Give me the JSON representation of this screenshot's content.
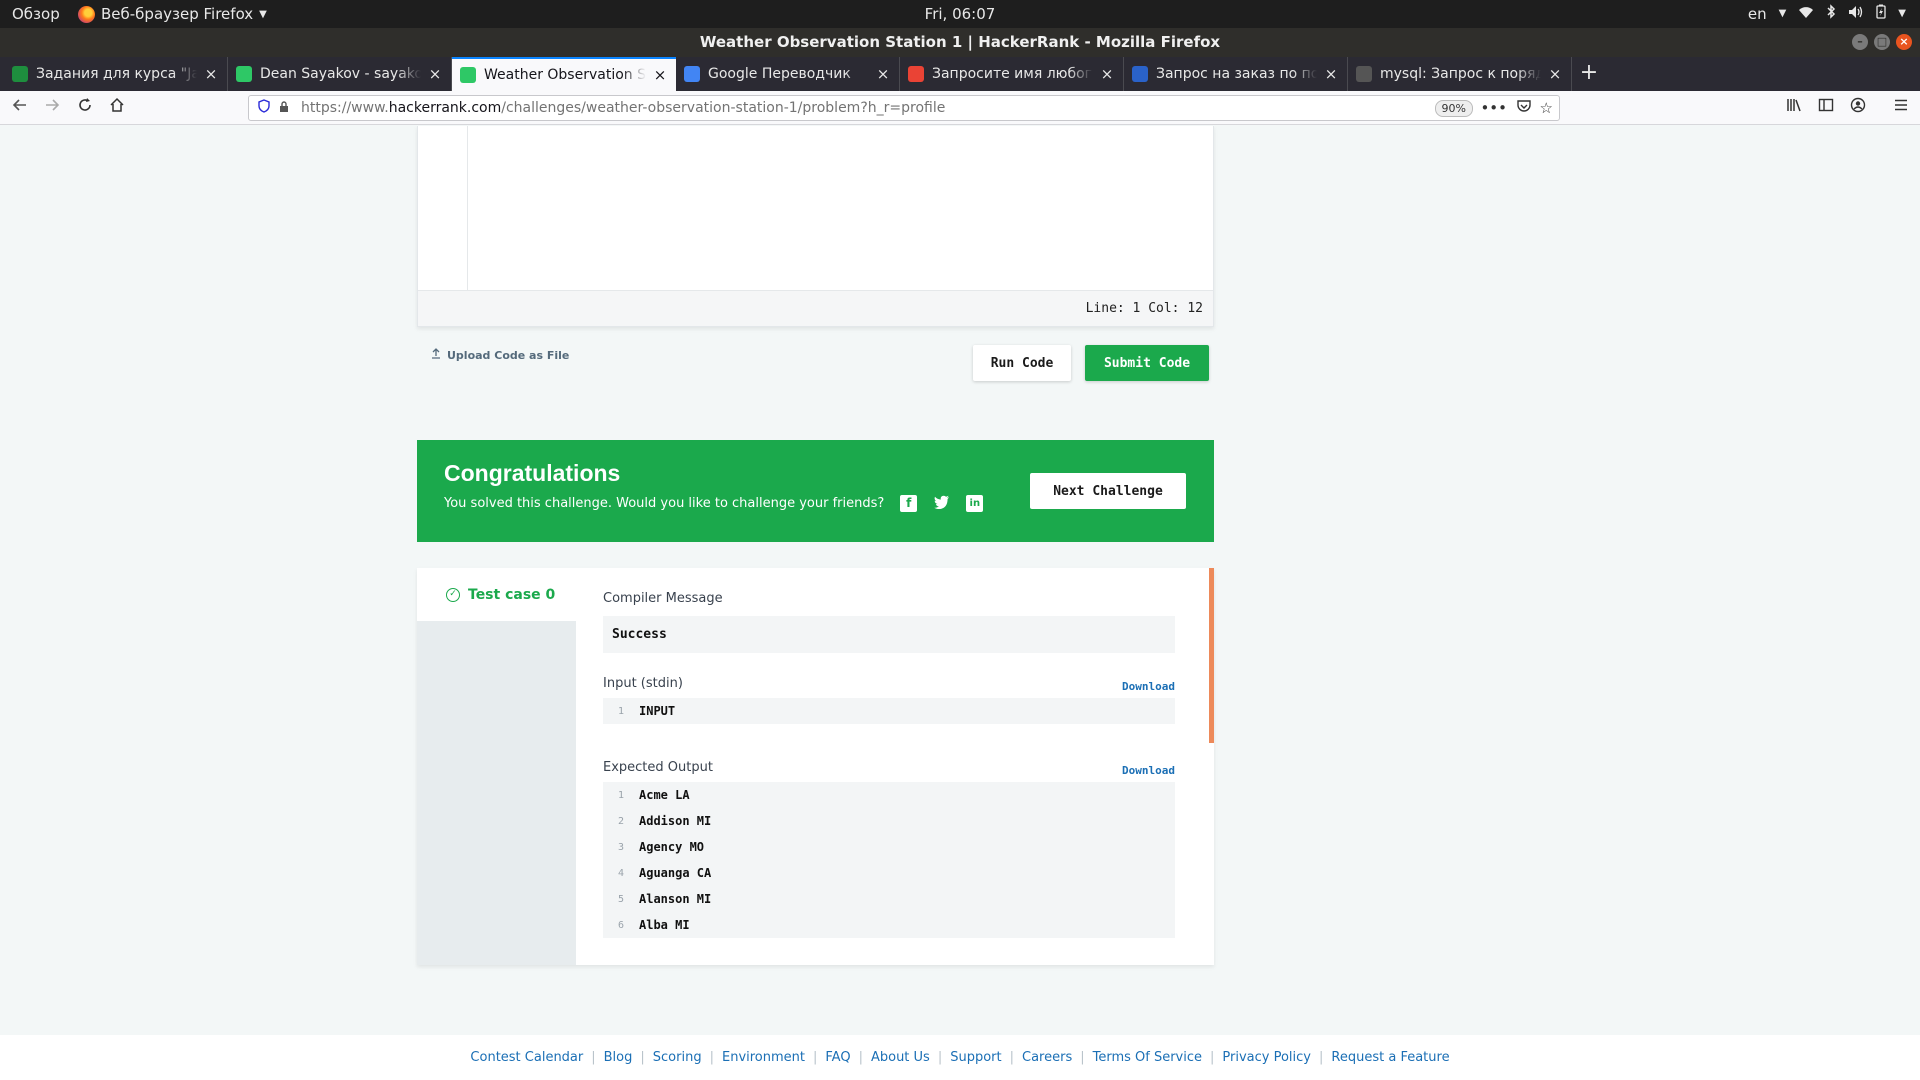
{
  "system": {
    "activities": "Обзор",
    "app_name": "Веб-браузер Firefox",
    "clock": "Fri, 06:07",
    "lang": "en"
  },
  "window": {
    "title": "Weather Observation Station 1 | HackerRank - Mozilla Firefox"
  },
  "tabs": [
    {
      "label": "Задания для курса \"Java",
      "favicon": "classroom-icon",
      "color": "#1e8e3e"
    },
    {
      "label": "Dean Sayakov - sayakovd",
      "favicon": "hackerrank-icon",
      "color": "#2ec866"
    },
    {
      "label": "Weather Observation Sta",
      "favicon": "hackerrank-icon",
      "color": "#2ec866"
    },
    {
      "label": "Google Переводчик",
      "favicon": "translate-icon",
      "color": "#4285f4"
    },
    {
      "label": "Запросите имя любого г",
      "favicon": "google-icon",
      "color": "#ea4335"
    },
    {
      "label": "Запрос на заказ по посл",
      "favicon": "site-icon",
      "color": "#2a62c9"
    },
    {
      "label": "mysql: Запрос к порядку",
      "favicon": "docs-icon",
      "color": "#555555"
    }
  ],
  "active_tab_index": 2,
  "navbar": {
    "url_prefix": "https://www.",
    "url_domain": "hackerrank.com",
    "url_path": "/challenges/weather-observation-station-1/problem?h_r=profile",
    "zoom": "90%"
  },
  "editor": {
    "status": "Line: 1 Col: 12"
  },
  "actions": {
    "upload": "Upload Code as File",
    "run": "Run Code",
    "submit": "Submit Code"
  },
  "congrats": {
    "title": "Congratulations",
    "subtitle": "You solved this challenge. Would you like to challenge your friends?",
    "next": "Next Challenge"
  },
  "results": {
    "test_case": "Test case 0",
    "compiler_label": "Compiler Message",
    "compiler_message": "Success",
    "input_label": "Input (stdin)",
    "download": "Download",
    "input_lines": [
      {
        "n": "1",
        "text": "INPUT"
      }
    ],
    "expected_label": "Expected Output",
    "expected_lines": [
      {
        "n": "1",
        "text": "Acme LA"
      },
      {
        "n": "2",
        "text": "Addison MI"
      },
      {
        "n": "3",
        "text": "Agency MO"
      },
      {
        "n": "4",
        "text": "Aguanga CA"
      },
      {
        "n": "5",
        "text": "Alanson MI"
      },
      {
        "n": "6",
        "text": "Alba MI"
      }
    ]
  },
  "footer": {
    "links": [
      "Contest Calendar",
      "Blog",
      "Scoring",
      "Environment",
      "FAQ",
      "About Us",
      "Support",
      "Careers",
      "Terms Of Service",
      "Privacy Policy",
      "Request a Feature"
    ]
  },
  "colors": {
    "brand_green": "#1ba94c",
    "link_blue": "#1b6fb5",
    "scroll_accent": "#ed8a5a"
  }
}
